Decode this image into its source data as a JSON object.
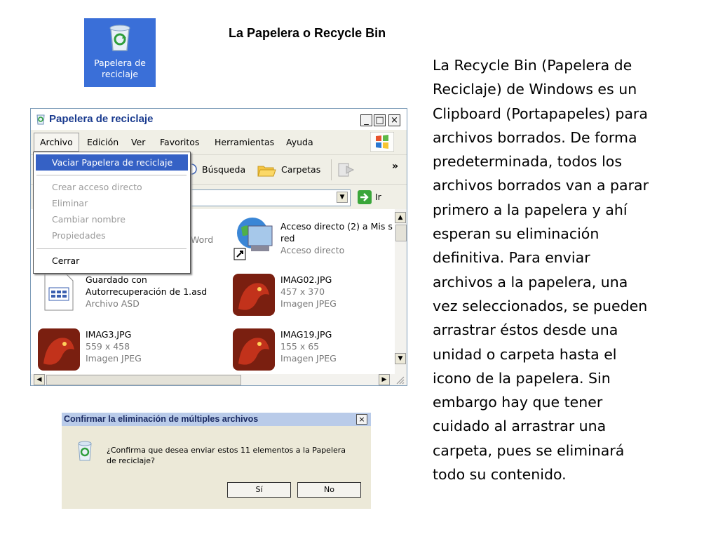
{
  "desktop_icon": {
    "label_line1": "Papelera de",
    "label_line2": "reciclaje",
    "icon": "recycle-bin-icon"
  },
  "slide": {
    "title": "La Papelera o Recycle Bin",
    "body": "La Recycle Bin (Papelera de\nReciclaje) de Windows es un\nClipboard (Portapapeles) para\narchivos borrados. De forma\npredeterminada, todos los\narchivos borrados van a parar\nprimero a la papelera y ahí\nesperan su eliminación\ndefinitiva. Para enviar\narchivos a la papelera, una\nvez seleccionados, se pueden\narrastrar éstos desde una\nunidad o carpeta hasta el\nicono de la papelera. Sin\nembargo hay que tener\ncuidado al arrastrar una\ncarpeta, pues se eliminará\ntodo su contenido."
  },
  "window": {
    "title": "Papelera de reciclaje",
    "caption_buttons": {
      "minimize": "_",
      "maximize": "□",
      "close": "×"
    },
    "menu": [
      "Archivo",
      "Edición",
      "Ver",
      "Favoritos",
      "Herramientas",
      "Ayuda"
    ],
    "toolbar": {
      "search": "Búsqueda",
      "folders": "Carpetas",
      "more": "»"
    },
    "address": {
      "go_label": "Ir"
    },
    "files": [
      {
        "name_line1": "Acceso directo (2) a Mis s",
        "name_line2": "red",
        "sub1": "Acceso directo",
        "sub2": ""
      },
      {
        "name_line1": "Guardado con",
        "name_line2": "Autorrecuperación de 1.asd",
        "sub1": "Archivo ASD",
        "sub2": ""
      },
      {
        "name_line1": "IMAG02.JPG",
        "name_line2": "",
        "sub1": "457 x 370",
        "sub2": "Imagen JPEG"
      },
      {
        "name_line1": "IMAG3.JPG",
        "name_line2": "",
        "sub1": "559 x 458",
        "sub2": "Imagen JPEG"
      },
      {
        "name_line1": "IMAG19.JPG",
        "name_line2": "",
        "sub1": "155 x 65",
        "sub2": "Imagen JPEG"
      }
    ],
    "partial_word": "Word"
  },
  "dropdown": {
    "items": [
      "Vaciar Papelera de reciclaje",
      "Crear acceso directo",
      "Eliminar",
      "Cambiar nombre",
      "Propiedades",
      "Cerrar"
    ]
  },
  "dialog": {
    "title": "Confirmar la eliminación de múltiples archivos",
    "close": "×",
    "message": "¿Confirma que desea enviar estos 11 elementos a la Papelera de reciclaje?",
    "yes": "Sí",
    "no": "No"
  }
}
